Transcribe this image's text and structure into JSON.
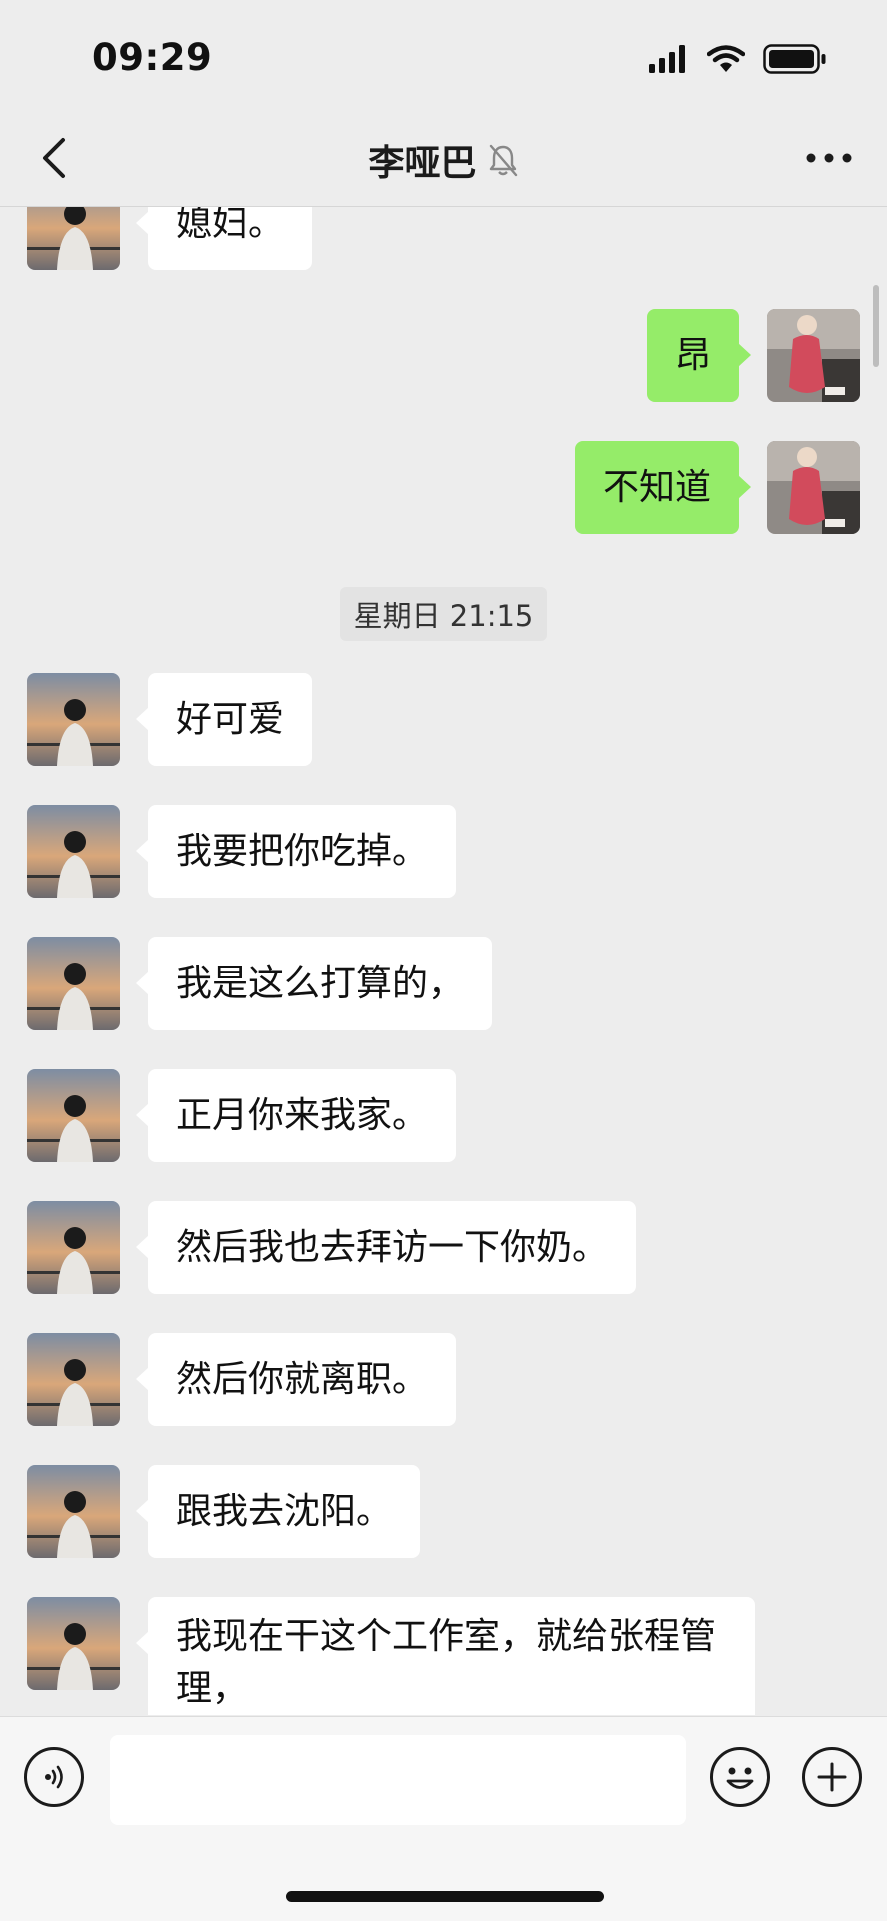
{
  "status_bar": {
    "time": "09:29"
  },
  "header": {
    "title": "李哑巴",
    "muted_icon": "bell-slash-icon",
    "back_icon": "chevron-left-icon",
    "more_icon": "ellipsis-icon"
  },
  "messages": [
    {
      "dir": "in",
      "text": "媳妇。"
    },
    {
      "dir": "out",
      "text": "昂"
    },
    {
      "dir": "out",
      "text": "不知道"
    },
    {
      "dir": "time",
      "text": "星期日 21:15"
    },
    {
      "dir": "in",
      "text": "好可爱"
    },
    {
      "dir": "in",
      "text": "我要把你吃掉。"
    },
    {
      "dir": "in",
      "text": "我是这么打算的，"
    },
    {
      "dir": "in",
      "text": "正月你来我家。"
    },
    {
      "dir": "in",
      "text": "然后我也去拜访一下你奶。"
    },
    {
      "dir": "in",
      "text": "然后你就离职。"
    },
    {
      "dir": "in",
      "text": "跟我去沈阳。"
    },
    {
      "dir": "in",
      "text": "我现在干这个工作室，就给张程管理，"
    }
  ],
  "input_bar": {
    "value": "",
    "voice_icon": "voice-icon",
    "emoji_icon": "emoji-icon",
    "plus_icon": "plus-icon"
  },
  "colors": {
    "outgoing_bubble": "#95ec69",
    "incoming_bubble": "#ffffff",
    "background": "#ededed"
  }
}
